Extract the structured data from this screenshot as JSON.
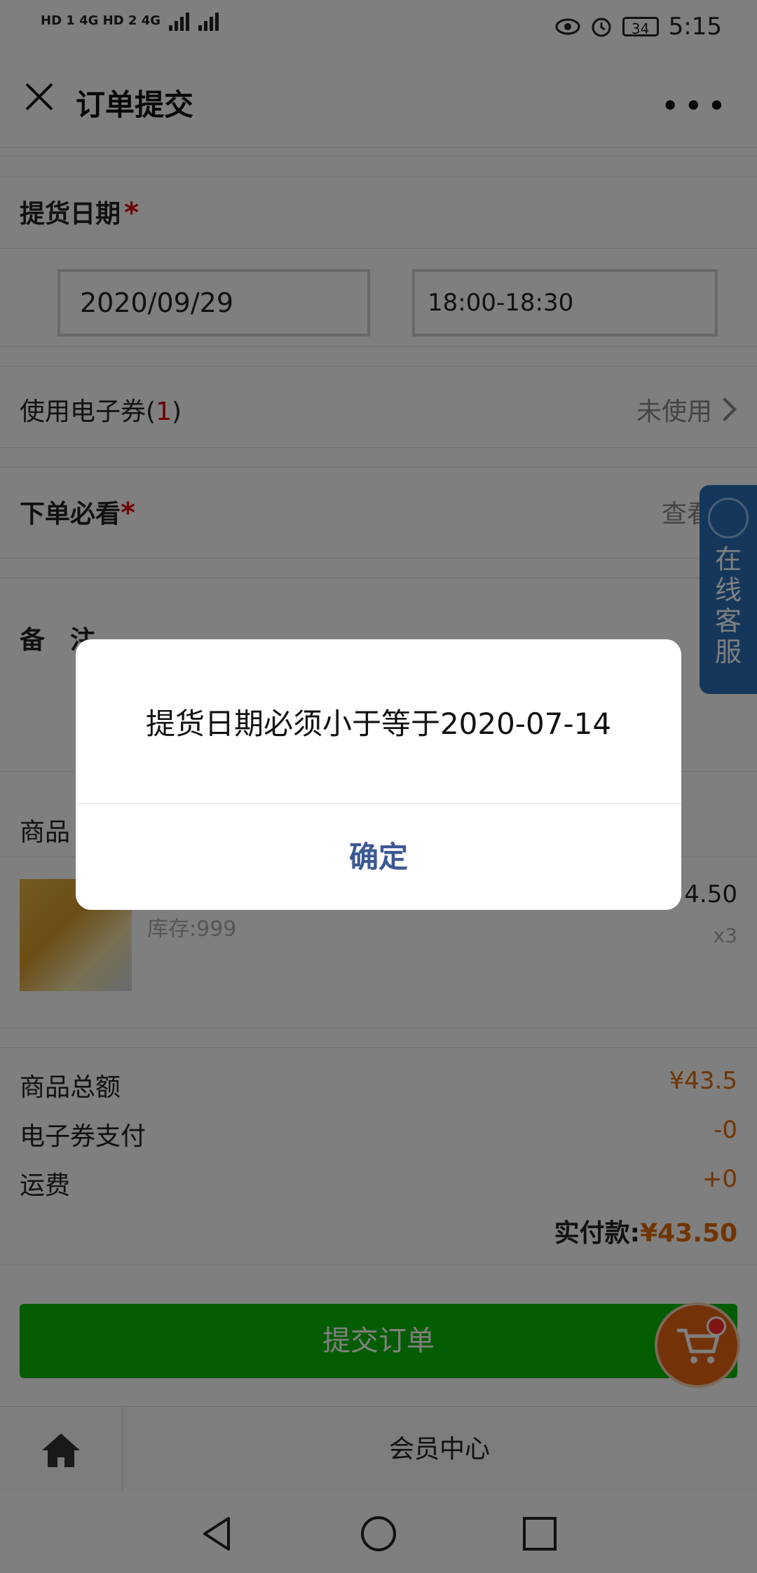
{
  "status_bar": {
    "left_text": "HD 1 4G HD 2 4G",
    "battery": "34",
    "time": "5:15"
  },
  "header": {
    "title": "订单提交",
    "more_label": "•••"
  },
  "pickup": {
    "label": "提货日期",
    "required_mark": "*",
    "date_value": "2020/09/29",
    "time_value": "18:00-18:30"
  },
  "coupon": {
    "label_prefix": "使用电子券(",
    "count": "1",
    "label_suffix": ")",
    "status": "未使用"
  },
  "must_read": {
    "label": "下单必看",
    "required_mark": "*",
    "link": "查看"
  },
  "remark": {
    "label": "备　注"
  },
  "goods": {
    "section_label": "商品",
    "price": "4.50",
    "stock": "库存:999",
    "qty": "x3"
  },
  "summary": {
    "total_label": "商品总额",
    "total_value": "¥43.5",
    "coupon_pay_label": "电子券支付",
    "coupon_pay_value": "-0",
    "shipping_label": "运费",
    "shipping_value": "+0",
    "pay_label": "实付款:",
    "pay_value": "¥43.50"
  },
  "submit_label": "提交订单",
  "service": {
    "text": [
      "在",
      "线",
      "客",
      "服"
    ]
  },
  "footer": {
    "member_label": "会员中心"
  },
  "dialog": {
    "message": "提货日期必须小于等于2020-07-14",
    "confirm_label": "确定"
  },
  "colors": {
    "accent_green": "#09bb07",
    "price_orange": "#e06a00",
    "dialog_button": "#3b5894",
    "required_red": "#dd0000"
  }
}
